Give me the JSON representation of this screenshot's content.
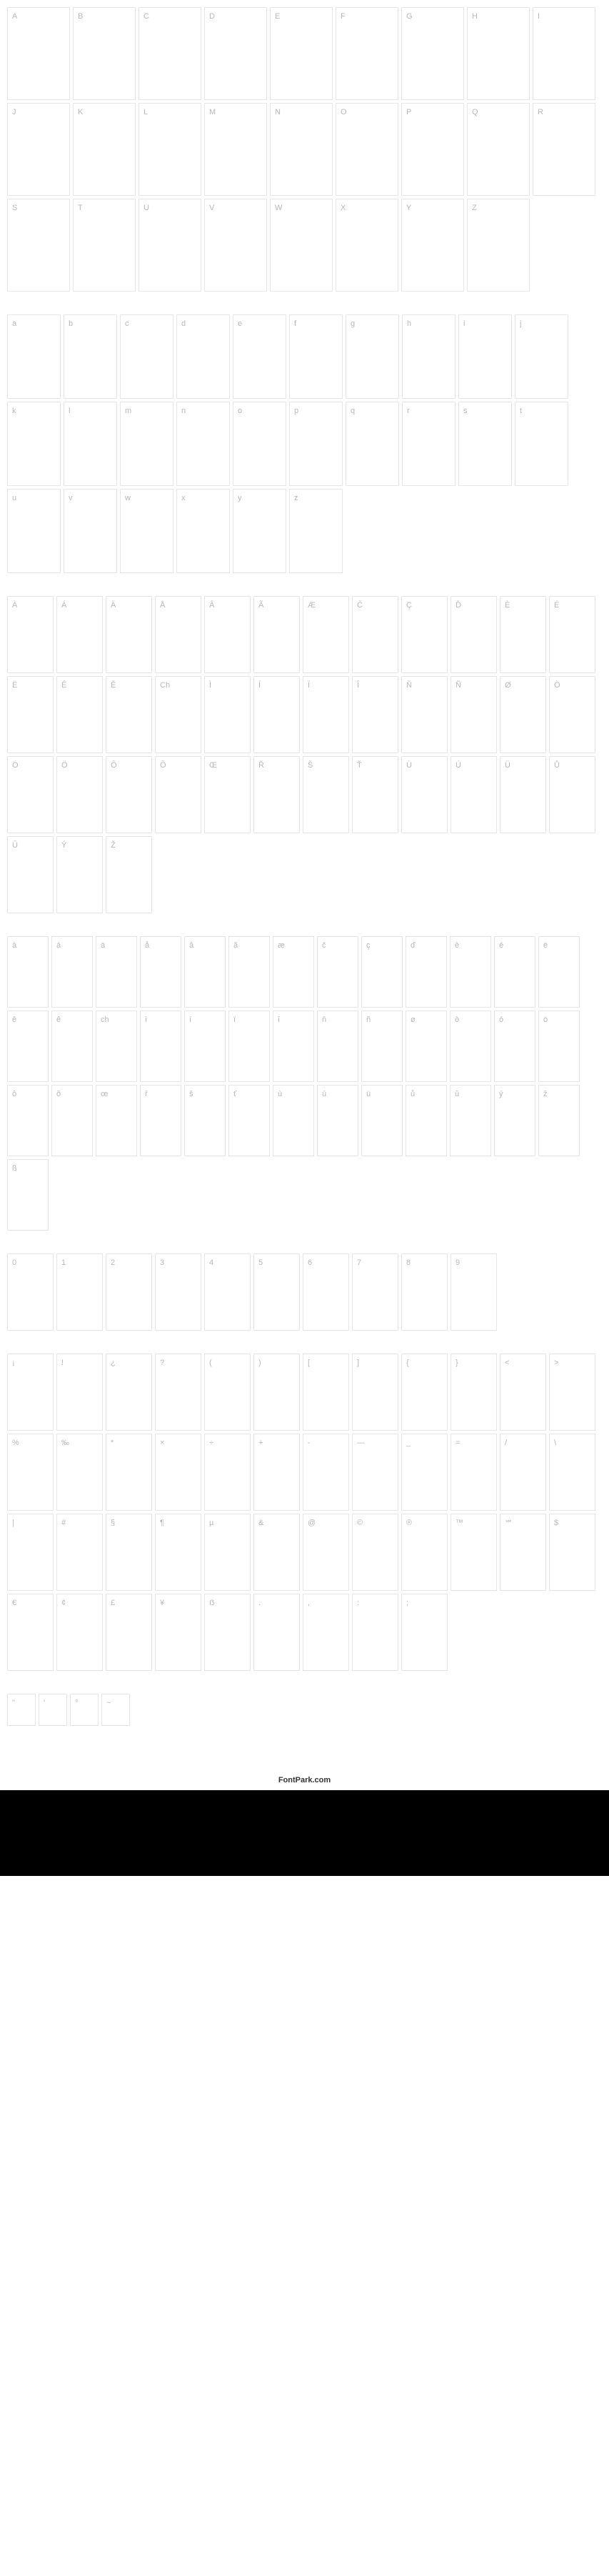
{
  "footer_label": "FontPark.com",
  "groups": [
    {
      "class": "g-upper",
      "cells": [
        "A",
        "B",
        "C",
        "D",
        "E",
        "F",
        "G",
        "H",
        "I",
        "J",
        "K",
        "L",
        "M",
        "N",
        "O",
        "P",
        "Q",
        "R",
        "S",
        "T",
        "U",
        "V",
        "W",
        "X",
        "Y",
        "Z"
      ]
    },
    {
      "class": "g-lower",
      "cells": [
        "a",
        "b",
        "c",
        "d",
        "e",
        "f",
        "g",
        "h",
        "i",
        "j",
        "k",
        "l",
        "m",
        "n",
        "o",
        "p",
        "q",
        "r",
        "s",
        "t",
        "u",
        "v",
        "w",
        "x",
        "y",
        "z"
      ]
    },
    {
      "class": "g-accent-upper",
      "cells": [
        "À",
        "Á",
        "Ä",
        "Å",
        "Â",
        "Ã",
        "Æ",
        "Č",
        "Ç",
        "Ď",
        "È",
        "É",
        "Ë",
        "Ê",
        "Ě",
        "Ch",
        "Ì",
        "Í",
        "Ï",
        "Î",
        "Ň",
        "Ñ",
        "Ø",
        "Ò",
        "Ó",
        "Ö",
        "Ô",
        "Õ",
        "Œ",
        "Ř",
        "Š",
        "Ť",
        "Ù",
        "Ú",
        "Ü",
        "Ů",
        "Û",
        "Ý",
        "Ž"
      ]
    },
    {
      "class": "g-accent-lower",
      "cells": [
        "à",
        "á",
        "ä",
        "å",
        "â",
        "ã",
        "æ",
        "č",
        "ç",
        "ď",
        "è",
        "é",
        "ë",
        "ě",
        "ê",
        "ch",
        "ì",
        "í",
        "ï",
        "î",
        "ň",
        "ñ",
        "ø",
        "ò",
        "ó",
        "ö",
        "ô",
        "õ",
        "œ",
        "ř",
        "š",
        "ť",
        "ù",
        "ú",
        "ü",
        "ů",
        "û",
        "ý",
        "ž",
        "ß"
      ]
    },
    {
      "class": "g-digits",
      "cells": [
        "0",
        "1",
        "2",
        "3",
        "4",
        "5",
        "6",
        "7",
        "8",
        "9"
      ]
    },
    {
      "class": "g-symbols",
      "cells": [
        "¡",
        "!",
        "¿",
        "?",
        "(",
        ")",
        "[",
        "]",
        "{",
        "}",
        "<",
        ">",
        "%",
        "‰",
        "*",
        "×",
        "÷",
        "+",
        "-",
        "—",
        "_",
        "=",
        "/",
        "\\",
        "|",
        "#",
        "§",
        "¶",
        "µ",
        "&",
        "@",
        "©",
        "®",
        "™",
        "℠",
        "$",
        "€",
        "¢",
        "£",
        "¥",
        "ẞ",
        ".",
        ",",
        ":",
        ";"
      ]
    },
    {
      "class": "g-tiny",
      "cells": [
        "\"",
        "'",
        "°",
        "~"
      ]
    }
  ]
}
